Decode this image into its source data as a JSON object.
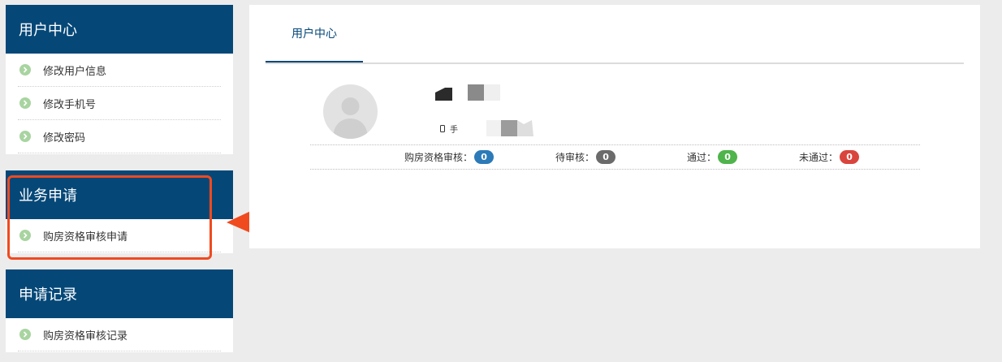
{
  "sidebar": {
    "sections": [
      {
        "title": "用户中心",
        "items": [
          "修改用户信息",
          "修改手机号",
          "修改密码"
        ]
      },
      {
        "title": "业务申请",
        "items": [
          "购房资格审核申请"
        ]
      },
      {
        "title": "申请记录",
        "items": [
          "购房资格审核记录"
        ]
      }
    ]
  },
  "main": {
    "tab": "用户中心",
    "phone_label": "手",
    "stats": [
      {
        "label": "购房资格审核：",
        "value": "0",
        "color": "#2c7ab8"
      },
      {
        "label": "待审核：",
        "value": "0",
        "color": "#6b6b6b"
      },
      {
        "label": "通过：",
        "value": "0",
        "color": "#4fb44b"
      },
      {
        "label": "未通过：",
        "value": "0",
        "color": "#d9453d"
      }
    ]
  },
  "colors": {
    "header_bg": "#054878",
    "highlight": "#f04a1f"
  }
}
